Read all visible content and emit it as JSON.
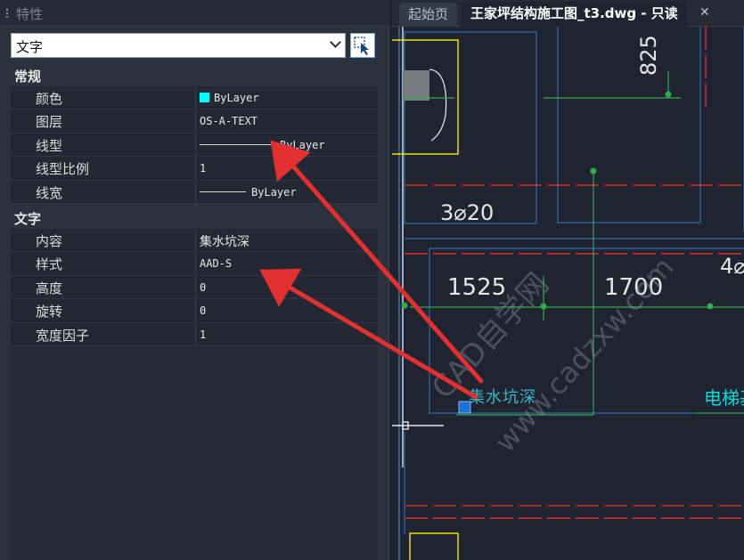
{
  "palette": {
    "title": "特性",
    "object_type": "文字",
    "sections": [
      {
        "name": "常规",
        "rows": [
          {
            "label": "颜色",
            "value": "ByLayer",
            "swatch_color": "#00ffff"
          },
          {
            "label": "图层",
            "value": "OS-A-TEXT"
          },
          {
            "label": "线型",
            "value": "ByLayer",
            "line_preview": true
          },
          {
            "label": "线型比例",
            "value": "1"
          },
          {
            "label": "线宽",
            "value": "ByLayer",
            "line_preview": true
          }
        ]
      },
      {
        "name": "文字",
        "rows": [
          {
            "label": "内容",
            "value": "集水坑深"
          },
          {
            "label": "样式",
            "value": "AAD-S"
          },
          {
            "label": "高度",
            "value": "0"
          },
          {
            "label": "旋转",
            "value": "0"
          },
          {
            "label": "宽度因子",
            "value": "1"
          }
        ]
      }
    ]
  },
  "tabs": {
    "start": "起始页",
    "active": "王家坪结构施工图_t3.dwg - 只读",
    "close_icon": "close-icon"
  },
  "drawing": {
    "dimensions": [
      "825",
      "3⌀20",
      "1525",
      "1700",
      "4⌀"
    ],
    "text_label": "电梯基",
    "selected_text": "集水坑深",
    "watermark_line1": "CAD自学网",
    "watermark_line2": "www.cadzxw.com",
    "annotation_color": "#e23030"
  }
}
